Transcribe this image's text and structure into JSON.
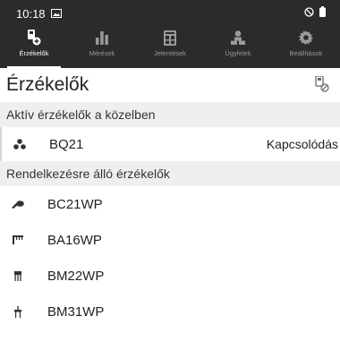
{
  "statusbar": {
    "time": "10:18"
  },
  "tabs": [
    {
      "label": "Érzékelők",
      "icon": "sensor-add-icon"
    },
    {
      "label": "Mérések",
      "icon": "bar-chart-icon"
    },
    {
      "label": "Jelentések",
      "icon": "report-icon"
    },
    {
      "label": "Ügyfelek",
      "icon": "customers-icon"
    },
    {
      "label": "Beállítások",
      "icon": "settings-gear-icon"
    }
  ],
  "page": {
    "title": "Érzékelők"
  },
  "active_section": {
    "heading": "Aktív érzékelők a közelben",
    "items": [
      {
        "name": "BQ21",
        "action": "Kapcsolódás"
      }
    ]
  },
  "available_section": {
    "heading": "Rendelkezésre álló érzékelők",
    "items": [
      {
        "name": "BC21WP",
        "icon": "sensor-probe-icon"
      },
      {
        "name": "BA16WP",
        "icon": "sensor-prong-icon"
      },
      {
        "name": "BM22WP",
        "icon": "sensor-pins-icon"
      },
      {
        "name": "BM31WP",
        "icon": "sensor-spike-icon"
      }
    ]
  },
  "colors": {
    "header": "#2b2b2b",
    "section_bg": "#efefef",
    "active_tab": "#ffffff",
    "inactive_tab": "#9a9a9a"
  }
}
